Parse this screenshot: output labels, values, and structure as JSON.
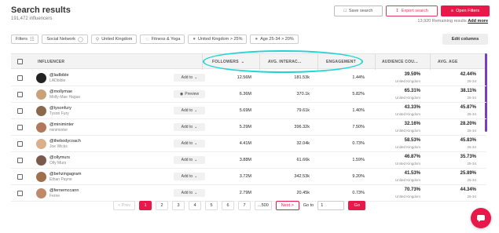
{
  "header": {
    "title": "Search results",
    "subtitle": "191,472 influencers",
    "save_label": "Save search",
    "export_label": "Export search",
    "open_label": "Open Filters",
    "remaining": "13,920 Remaining results",
    "add_more": "Add more"
  },
  "filters": {
    "filters_label": "Filters",
    "chips": [
      "Social Network",
      "United Kingdom",
      "Fitness & Yoga",
      "United Kingdom > 25%",
      "Age 25-34 > 20%"
    ],
    "edit_columns": "Edit columns"
  },
  "table": {
    "headers": {
      "influencer": "INFLUENCER",
      "followers": "FOLLOWERS",
      "avg_interactions": "AVG. INTERAC...",
      "engagement": "ENGAGEMENT",
      "audience_country": "AUDIENCE COU...",
      "avg_age": "AVG. AGE"
    },
    "rows": [
      {
        "handle": "@ladbible",
        "name": "LADbible",
        "action": "Add to",
        "followers": "12.56M",
        "avg_int": "181.53k",
        "engagement": "1.44%",
        "country_pct": "39.59%",
        "country": "United Kingdom",
        "age_pct": "42.44%",
        "age": "25-34"
      },
      {
        "handle": "@mollymae",
        "name": "Molly-Mae Hague",
        "action": "Preview",
        "followers": "6.36M",
        "avg_int": "370.1k",
        "engagement": "5.82%",
        "country_pct": "65.31%",
        "country": "United Kingdom",
        "age_pct": "38.11%",
        "age": "25-34"
      },
      {
        "handle": "@tysonfury",
        "name": "Tyson Fury",
        "action": "Add to",
        "followers": "5.69M",
        "avg_int": "79.61k",
        "engagement": "1.40%",
        "country_pct": "43.33%",
        "country": "United Kingdom",
        "age_pct": "45.87%",
        "age": "25-34"
      },
      {
        "handle": "@miniminter",
        "name": "miniminter",
        "action": "Add to",
        "followers": "5.29M",
        "avg_int": "396.32k",
        "engagement": "7.50%",
        "country_pct": "32.16%",
        "country": "United Kingdom",
        "age_pct": "28.20%",
        "age": "25-34"
      },
      {
        "handle": "@thebodycoach",
        "name": "Joe Wicks",
        "action": "Add to",
        "followers": "4.41M",
        "avg_int": "32.04k",
        "engagement": "0.73%",
        "country_pct": "58.53%",
        "country": "United Kingdom",
        "age_pct": "45.83%",
        "age": "25-34"
      },
      {
        "handle": "@ollymurs",
        "name": "Olly Murs",
        "action": "Add to",
        "followers": "3.88M",
        "avg_int": "61.66k",
        "engagement": "1.59%",
        "country_pct": "46.87%",
        "country": "United Kingdom",
        "age_pct": "35.73%",
        "age": "25-34"
      },
      {
        "handle": "@behzingagram",
        "name": "Ethan Payne",
        "action": "Add to",
        "followers": "3.72M",
        "avg_int": "342.53k",
        "engagement": "9.20%",
        "country_pct": "41.53%",
        "country": "United Kingdom",
        "age_pct": "25.89%",
        "age": "25-34"
      },
      {
        "handle": "@fernemccann",
        "name": "Ferne",
        "action": "Add to",
        "followers": "2.79M",
        "avg_int": "20.45k",
        "engagement": "0.73%",
        "country_pct": "70.73%",
        "country": "United Kingdom",
        "age_pct": "44.34%",
        "age": "25-34"
      }
    ]
  },
  "pager": {
    "prev": "< Prev",
    "pages": [
      "1",
      "2",
      "3",
      "4",
      "5",
      "6",
      "7",
      "...500"
    ],
    "next": "Next >",
    "goto_label": "Go to",
    "goto_value": "1",
    "go": "Go"
  },
  "colors": {
    "accent": "#e8194a",
    "highlight": "#22d3d3"
  }
}
